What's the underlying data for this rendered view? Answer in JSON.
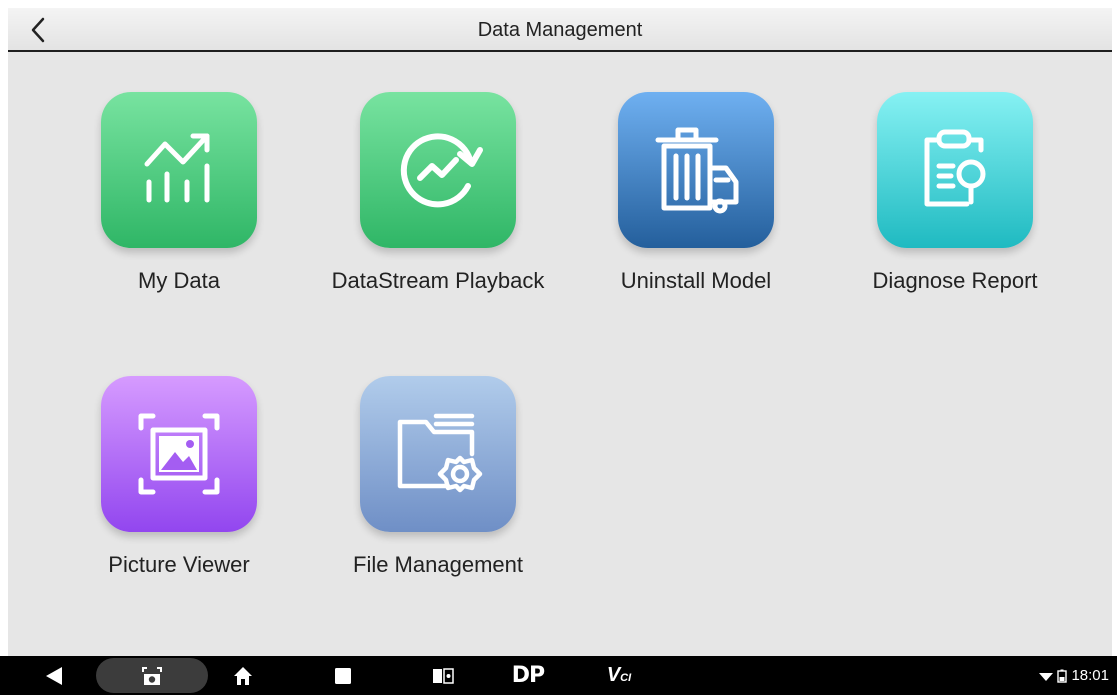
{
  "header": {
    "title": "Data Management",
    "back_icon": "chevron-left-icon"
  },
  "tiles": [
    {
      "label": "My Data",
      "icon": "chart-icon",
      "color_top": "#78e3a0",
      "color_bottom": "#2fb666"
    },
    {
      "label": "DataStream Playback",
      "icon": "playback-icon",
      "color_top": "#78e3a0",
      "color_bottom": "#2fb666"
    },
    {
      "label": "Uninstall Model",
      "icon": "trash-truck-icon",
      "color_top": "#6fb0f1",
      "color_bottom": "#245f9c"
    },
    {
      "label": "Diagnose Report",
      "icon": "report-icon",
      "color_top": "#86f1f3",
      "color_bottom": "#1fbac1"
    },
    {
      "label": "Picture Viewer",
      "icon": "picture-icon",
      "color_top": "#d69bff",
      "color_bottom": "#9246ef"
    },
    {
      "label": "File Management",
      "icon": "folder-gear-icon",
      "color_top": "#b1cceb",
      "color_bottom": "#6f8fc6"
    }
  ],
  "navbar": {
    "dp_label": "DP",
    "vci_label": "V",
    "vci_sub": "CI",
    "time": "18:01"
  }
}
